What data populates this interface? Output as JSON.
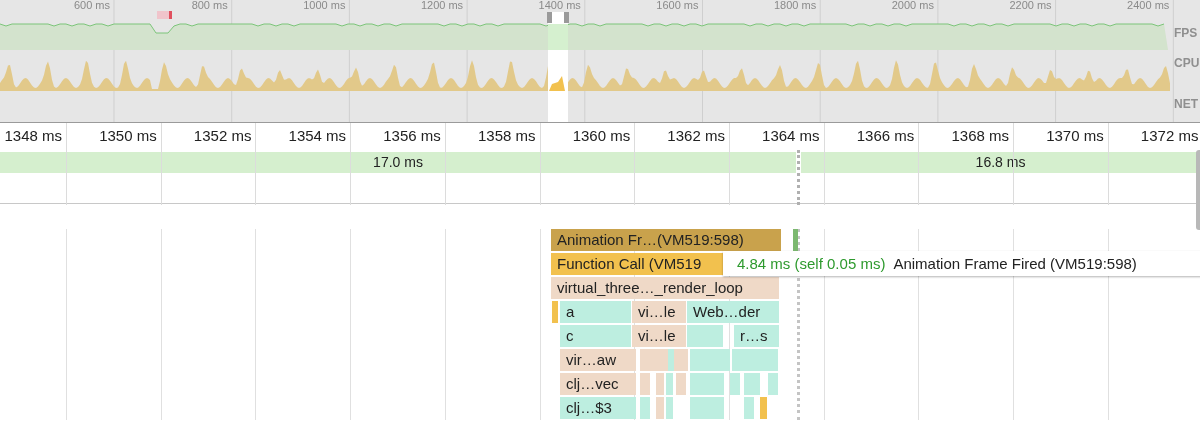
{
  "overview": {
    "time_labels": [
      "600 ms",
      "800 ms",
      "1000 ms",
      "1200 ms",
      "1400 ms",
      "1600 ms",
      "1800 ms",
      "2000 ms",
      "2200 ms",
      "2400 ms"
    ],
    "track_labels": [
      "FPS",
      "CPU",
      "NET"
    ]
  },
  "ruler": {
    "labels": [
      "1348 ms",
      "1350 ms",
      "1352 ms",
      "1354 ms",
      "1356 ms",
      "1358 ms",
      "1360 ms",
      "1362 ms",
      "1364 ms",
      "1366 ms",
      "1368 ms",
      "1370 ms",
      "1372 ms"
    ]
  },
  "frames": [
    {
      "duration": "17.0 ms"
    },
    {
      "duration": "16.8 ms"
    }
  ],
  "flame_chart": {
    "rows": [
      {
        "bars": [
          {
            "label": "Animation Fr…(VM519:598)",
            "kind": "frame"
          },
          {
            "kind": "mark"
          }
        ]
      },
      {
        "bars": [
          {
            "label": "Function Call (VM519",
            "kind": "call"
          }
        ]
      },
      {
        "bars": [
          {
            "label": "virtual_three…_render_loop",
            "kind": "script"
          }
        ]
      },
      {
        "bars": [
          {
            "kind": "call"
          },
          {
            "label": "a",
            "kind": "native"
          },
          {
            "label": "vi…le",
            "kind": "script"
          },
          {
            "label": "Web…der",
            "kind": "native"
          }
        ]
      },
      {
        "bars": [
          {
            "label": "c",
            "kind": "native"
          },
          {
            "label": "vi…le",
            "kind": "script"
          },
          {
            "kind": "native"
          },
          {
            "label": "r…s",
            "kind": "native"
          }
        ]
      },
      {
        "bars": [
          {
            "label": "vir…aw",
            "kind": "script"
          },
          {
            "kind": "script"
          },
          {
            "kind": "native"
          },
          {
            "kind": "script"
          },
          {
            "kind": "native"
          },
          {
            "kind": "native"
          }
        ]
      },
      {
        "bars": [
          {
            "label": "clj…vec",
            "kind": "script"
          },
          {
            "kind": "script"
          },
          {
            "kind": "script"
          },
          {
            "kind": "native"
          },
          {
            "kind": "script"
          },
          {
            "kind": "native"
          },
          {
            "kind": "native"
          },
          {
            "kind": "native"
          },
          {
            "kind": "native"
          }
        ]
      },
      {
        "bars": [
          {
            "label": "clj…$3",
            "kind": "native"
          },
          {
            "kind": "native"
          },
          {
            "kind": "script"
          },
          {
            "kind": "native"
          },
          {
            "kind": "native"
          },
          {
            "kind": "native"
          },
          {
            "kind": "call"
          }
        ]
      }
    ]
  },
  "tooltip": {
    "duration": "4.84 ms (self 0.05 ms)",
    "title": "Animation Frame Fired (VM519:598)"
  }
}
